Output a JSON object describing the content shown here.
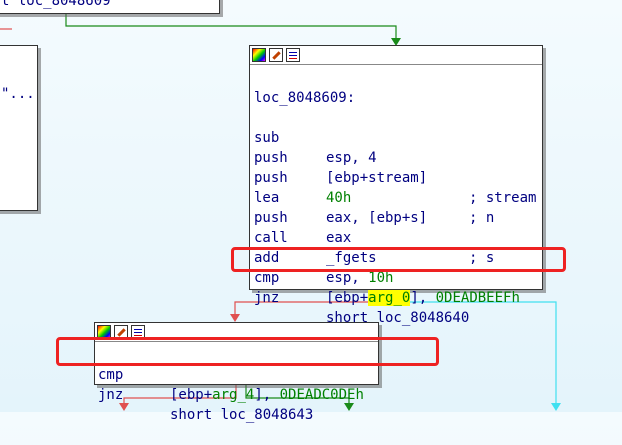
{
  "colors": {
    "edge_red": "#e05050",
    "edge_green": "#1a8a1a",
    "edge_cyan": "#40e0f0",
    "highlight_box": "#ee2222",
    "selected_operand_bg": "#ffff00"
  },
  "top_left_block": {
    "partial_text": "t loc_8048609",
    "partial_frag": "\"..."
  },
  "main_block": {
    "toolbar_icons": [
      "graph-icon",
      "edit-icon",
      "list-icon"
    ],
    "label": "loc_8048609:",
    "lines": [
      {
        "mn": "sub",
        "op": "esp, 4",
        "cmt": ""
      },
      {
        "mn": "push",
        "op": "[ebp+stream]",
        "cmt": "; stream"
      },
      {
        "mn": "push",
        "op": "40h",
        "cmt": "; n"
      },
      {
        "mn": "lea",
        "op": "eax, [ebp+s]",
        "cmt": ""
      },
      {
        "mn": "push",
        "op": "eax",
        "cmt": "; s"
      },
      {
        "mn": "call",
        "op": "_fgets",
        "cmt": ""
      },
      {
        "mn": "add",
        "op": "esp, 10h",
        "cmt": ""
      },
      {
        "mn": "cmp",
        "op_pre": "[ebp+",
        "op_hl": "arg_0",
        "op_post": "], ",
        "op_num": "0DEADBEEFh",
        "cmt": ""
      },
      {
        "mn": "jnz",
        "op": "short loc_8048640",
        "cmt": ""
      }
    ]
  },
  "bottom_block": {
    "toolbar_icons": [
      "graph-icon",
      "edit-icon",
      "list-icon"
    ],
    "lines": [
      {
        "mn": "cmp",
        "op_pre": "[ebp+",
        "op_var": "arg_4",
        "op_post": "], ",
        "op_num": "0DEADC0DEh"
      },
      {
        "mn": "jnz",
        "op": "short loc_8048643"
      }
    ]
  }
}
